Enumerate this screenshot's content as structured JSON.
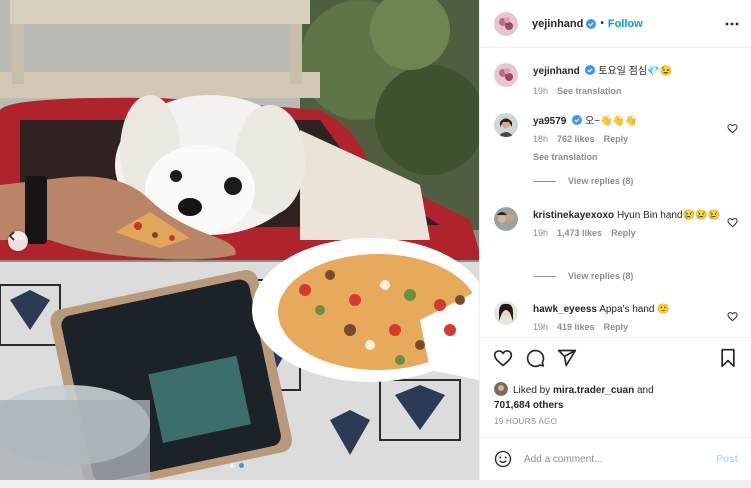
{
  "post": {
    "author": "yejinhand",
    "follow_label": "Follow",
    "separator": "•",
    "caption_text": "토요일 점심💎😉",
    "caption_age": "19h",
    "see_translation": "See translation"
  },
  "comments": [
    {
      "user": "ya9579",
      "verified": true,
      "text": "오~👋👋👋",
      "age": "18h",
      "likes": "762 likes",
      "reply": "Reply",
      "see_translation": "See translation",
      "view_replies": "View replies (8)"
    },
    {
      "user": "kristinekayexoxo",
      "verified": false,
      "text": "Hyun Bin hand😢😢😢",
      "age": "19h",
      "likes": "1,473 likes",
      "reply": "Reply",
      "view_replies": "View replies (8)"
    },
    {
      "user": "hawk_eyeess",
      "verified": false,
      "text": "Appa's hand 🙂",
      "age": "19h",
      "likes": "419 likes",
      "reply": "Reply"
    }
  ],
  "likes": {
    "prefix": "Liked by",
    "user": "mira.trader_cuan",
    "and": "and",
    "others": "701,684 others"
  },
  "timestamp": "19 HOURS AGO",
  "composer": {
    "placeholder": "Add a comment...",
    "post_label": "Post"
  },
  "icons": {
    "more": "more-horizontal-icon",
    "heart": "heart-icon",
    "comment": "comment-icon",
    "share": "paper-plane-icon",
    "save": "bookmark-icon",
    "emoji": "emoji-icon",
    "verified": "verified-badge-icon",
    "prev": "chevron-left-icon"
  },
  "colors": {
    "accent": "#0095f6",
    "verified": "#3897f0",
    "muted": "#8e8e8e",
    "post_disabled": "#b2dffc"
  },
  "carousel": {
    "total": 2,
    "active": 1
  }
}
